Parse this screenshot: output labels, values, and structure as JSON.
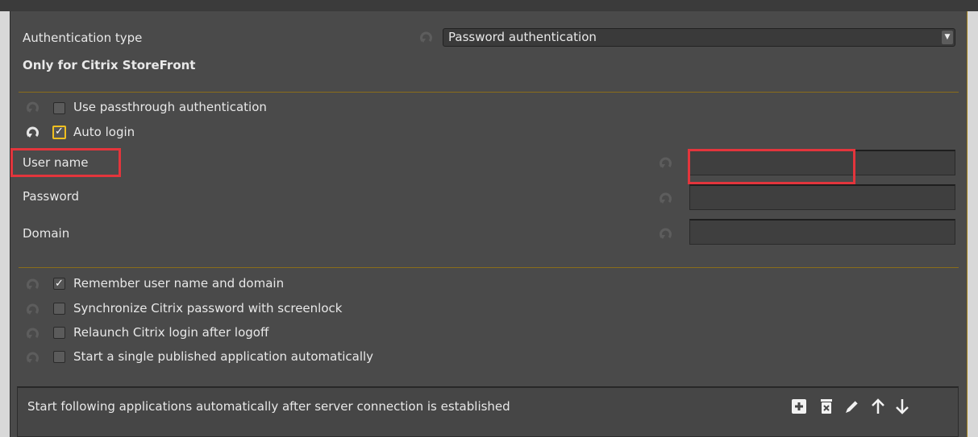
{
  "auth": {
    "type_label": "Authentication type",
    "type_value": "Password authentication",
    "storefront_note": "Only for Citrix StoreFront"
  },
  "options_top": [
    {
      "label": "Use passthrough authentication",
      "checked": false
    },
    {
      "label": "Auto login",
      "checked": true
    }
  ],
  "credentials": {
    "username_label": "User name",
    "username_value": "",
    "password_label": "Password",
    "password_value": "",
    "domain_label": "Domain",
    "domain_value": ""
  },
  "options_bottom": [
    {
      "label": "Remember user name and domain",
      "checked": true
    },
    {
      "label": "Synchronize Citrix password with screenlock",
      "checked": false
    },
    {
      "label": "Relaunch Citrix login after logoff",
      "checked": false
    },
    {
      "label": "Start a single published application automatically",
      "checked": false
    }
  ],
  "apps": {
    "header": "Start following applications automatically after server connection is established",
    "toolbar_icons": [
      "add-icon",
      "delete-icon",
      "edit-icon",
      "arrow-up-icon",
      "arrow-down-icon"
    ]
  },
  "check_glyph": "✓",
  "dropdown_glyph": "▼",
  "colors": {
    "panel": "#4a4a4a",
    "accent_separator": "#8a6d1a",
    "focus_checkbox": "#f0c020",
    "highlight_box": "#e3353c"
  }
}
